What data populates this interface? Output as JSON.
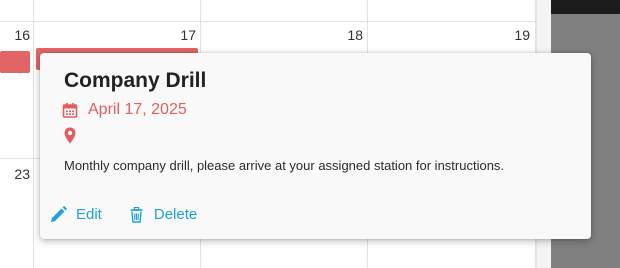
{
  "calendar": {
    "week1": [
      "16",
      "17",
      "18",
      "19"
    ],
    "week2": [
      "23"
    ]
  },
  "popover": {
    "title": "Company Drill",
    "date": "April 17, 2025",
    "location": "",
    "description": "Monthly company drill, please arrive at your assigned station for instructions.",
    "edit_label": "Edit",
    "delete_label": "Delete"
  },
  "colors": {
    "event": "#e36464",
    "date_accent": "#e35d5d",
    "action_link": "#1ba3dc"
  },
  "icons": {
    "date": "calendar-icon",
    "location": "map-pin-icon",
    "edit": "pencil-icon",
    "delete": "trash-icon"
  }
}
